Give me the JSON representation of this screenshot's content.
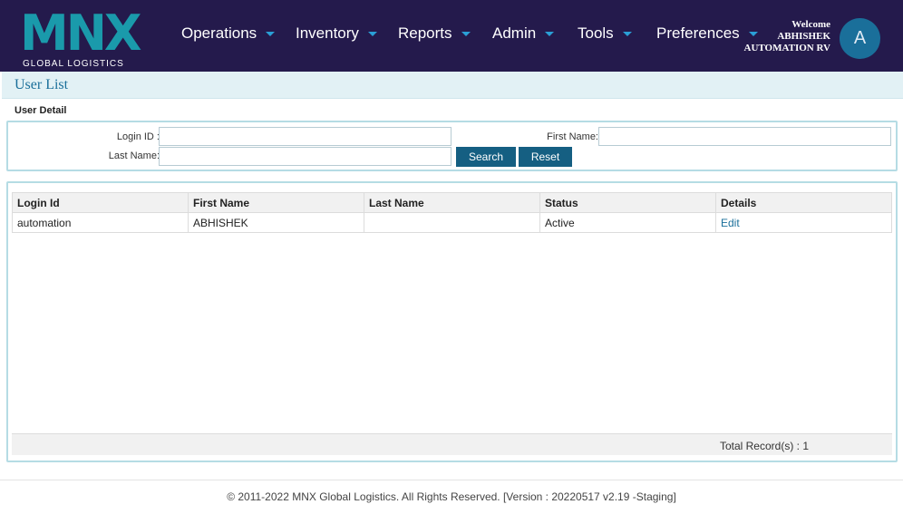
{
  "brand": {
    "mark": "MNX",
    "subtitle": "GLOBAL LOGISTICS",
    "color": "#1a9aab"
  },
  "nav": [
    {
      "label": "Operations"
    },
    {
      "label": "Inventory"
    },
    {
      "label": "Reports"
    },
    {
      "label": "Admin"
    },
    {
      "label": "Tools"
    },
    {
      "label": "Preferences"
    }
  ],
  "user": {
    "welcome": "Welcome",
    "first": "ABHISHEK",
    "last": "AUTOMATION RV",
    "avatar_initial": "A"
  },
  "page": {
    "title": "User List",
    "section": "User Detail"
  },
  "filters": {
    "login_id_label": "Login ID :",
    "login_id_value": "",
    "first_name_label": "First Name:",
    "first_name_value": "",
    "last_name_label": "Last Name:",
    "last_name_value": "",
    "search_label": "Search",
    "reset_label": "Reset"
  },
  "table": {
    "columns": [
      "Login Id",
      "First Name",
      "Last Name",
      "Status",
      "Details"
    ],
    "rows": [
      {
        "login_id": "automation",
        "first_name": "ABHISHEK",
        "last_name": "",
        "status": "Active",
        "details": "Edit"
      }
    ],
    "total": "Total Record(s) : 1"
  },
  "footer": {
    "copyright": "© 2011-2022 MNX Global Logistics. All Rights Reserved. [Version : 20220517 v2.19 -Staging]"
  },
  "colors": {
    "header_bg": "#241a4c",
    "accent": "#155f82",
    "panel_border": "#b5dce4"
  }
}
